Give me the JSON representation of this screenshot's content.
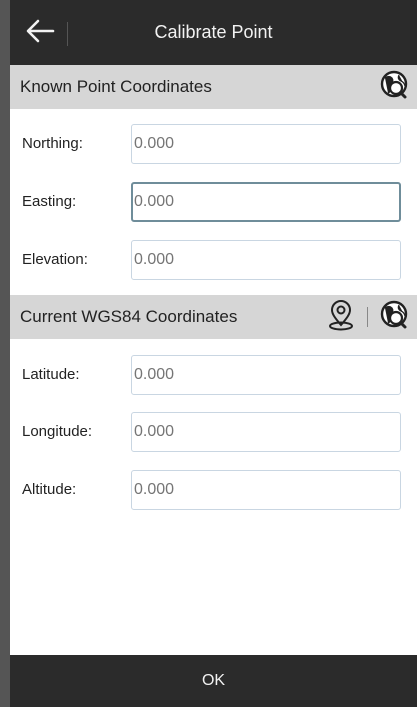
{
  "header": {
    "title": "Calibrate Point",
    "back_icon": "arrow-left-icon"
  },
  "known_section": {
    "title": "Known Point Coordinates",
    "icon": "globe-search-icon",
    "fields": [
      {
        "label": "Northing:",
        "value": "0.000"
      },
      {
        "label": "Easting:",
        "value": "0.000"
      },
      {
        "label": "Elevation:",
        "value": "0.000"
      }
    ]
  },
  "current_section": {
    "title": "Current WGS84 Coordinates",
    "icons": [
      "location-pin-icon",
      "globe-search-icon"
    ],
    "fields": [
      {
        "label": "Latitude:",
        "value": "0.000"
      },
      {
        "label": "Longitude:",
        "value": "0.000"
      },
      {
        "label": "Altitude:",
        "value": "0.000"
      }
    ]
  },
  "footer": {
    "ok_label": "OK"
  },
  "colors": {
    "bar_dark": "#2b2b2b",
    "section_bg": "#d6d6d6",
    "field_border": "#c9d6e2",
    "focused_border": "#6f8d9a"
  }
}
